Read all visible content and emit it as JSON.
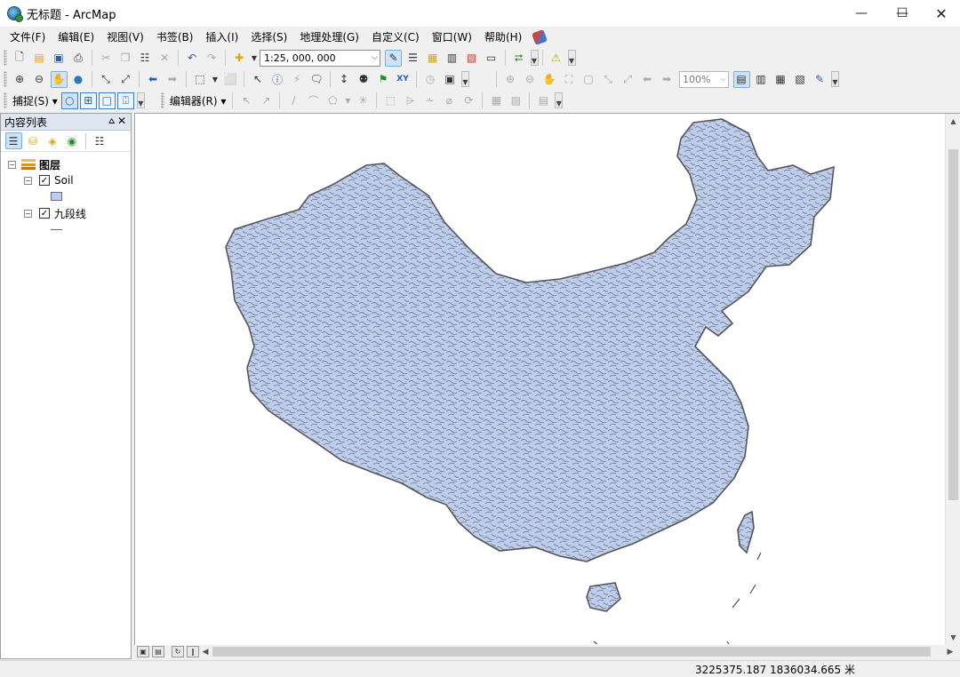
{
  "window": {
    "title": "无标题 - ArcMap"
  },
  "menu": [
    "文件(F)",
    "编辑(E)",
    "视图(V)",
    "书签(B)",
    "插入(I)",
    "选择(S)",
    "地理处理(G)",
    "自定义(C)",
    "窗口(W)",
    "帮助(H)"
  ],
  "standard_toolbar": {
    "scale": "1:25, 000, 000"
  },
  "tools_toolbar": {
    "zoom_level": "100%"
  },
  "snapping_toolbar": {
    "label": "捕捉(S)"
  },
  "editor_toolbar": {
    "label": "编辑器(R)"
  },
  "toc": {
    "title": "内容列表",
    "root_label": "图层",
    "layers": [
      {
        "name": "Soil",
        "checked": true,
        "symbol": "polygon",
        "fill": "#bccdee"
      },
      {
        "name": "九段线",
        "checked": true,
        "symbol": "line",
        "stroke": "#666666"
      }
    ]
  },
  "map": {
    "fill_color": "#bccdee",
    "outline_color": "#5a5a5a"
  },
  "status": {
    "coordinates": "3225375.187  1836034.665 米"
  }
}
